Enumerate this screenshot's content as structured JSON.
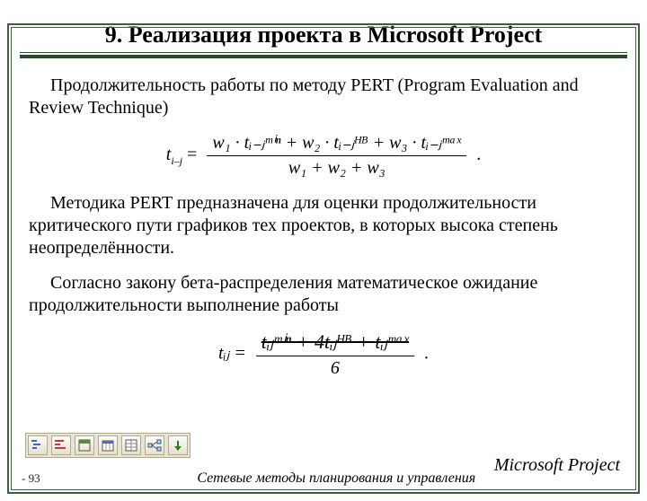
{
  "title": "9. Реализация проекта в Microsoft Project",
  "para1": "Продолжительность работы по методу PERT (Program Evaluation and Review Technique)",
  "formula1": {
    "lhs_base": "t",
    "lhs_sub": "i–j",
    "eq": "=",
    "num": "w₁ · tᵢ₋ⱼᵐⁱⁿ + w₂ · tᵢ₋ⱼᴴᴮ + w₃ · tᵢ₋ⱼᵐᵃˣ",
    "den": "w₁ + w₂ + w₃",
    "trail": "."
  },
  "para2": "Методика PERT предназначена для оценки продолжительности критического пути графиков тех проектов, в которых высока степень неопределённости.",
  "para3": "Согласно закону бета-распределения математическое ожидание продолжительности выполнение работы",
  "formula2": {
    "text_top": "tᵢⱼᵐⁱⁿ + 4tᵢⱼᴴᴮ + tᵢⱼᵐᵃˣ",
    "lhs": "tᵢⱼ =",
    "den": "6",
    "trail": "."
  },
  "toolbar": {
    "icons": [
      "gantt-icon",
      "tracking-icon",
      "resource-icon",
      "calendar-icon",
      "table-icon",
      "network-icon",
      "more-icon"
    ]
  },
  "footer": {
    "page": "- 93",
    "mid": "Сетевые методы планирования и управления",
    "right": "Microsoft Project"
  }
}
